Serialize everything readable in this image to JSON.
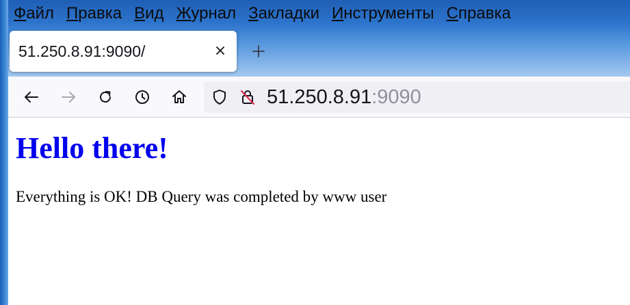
{
  "menubar": {
    "items": [
      {
        "accel": "Ф",
        "rest": "айл"
      },
      {
        "accel": "П",
        "rest": "равка"
      },
      {
        "accel": "В",
        "rest": "ид"
      },
      {
        "accel": "Ж",
        "rest": "урнал"
      },
      {
        "accel": "З",
        "rest": "акладки"
      },
      {
        "accel": "И",
        "rest": "нструменты"
      },
      {
        "accel": "С",
        "rest": "правка"
      }
    ]
  },
  "tabs": {
    "active": {
      "title": "51.250.8.91:9090/",
      "close_icon": "close-icon"
    },
    "new_tab_icon": "plus-icon"
  },
  "toolbar": {
    "back_icon": "back-arrow-icon",
    "forward_icon": "forward-arrow-icon",
    "reload_icon": "reload-icon",
    "history_icon": "clock-icon",
    "home_icon": "home-icon",
    "forward_disabled": true
  },
  "urlbar": {
    "host": "51.250.8.91",
    "port": ":9090",
    "shield_icon": "shield-icon",
    "insecure_icon": "insecure-lock-icon"
  },
  "page": {
    "heading": "Hello there!",
    "message": "Everything is OK! DB Query was completed by www user"
  },
  "colors": {
    "chrome_blue": "#2d74cc",
    "link_blue": "#0000ee",
    "toolbar_bg": "#f9f9fb",
    "urlbar_bg": "#f0f0f4",
    "insecure_red": "#e22850"
  }
}
